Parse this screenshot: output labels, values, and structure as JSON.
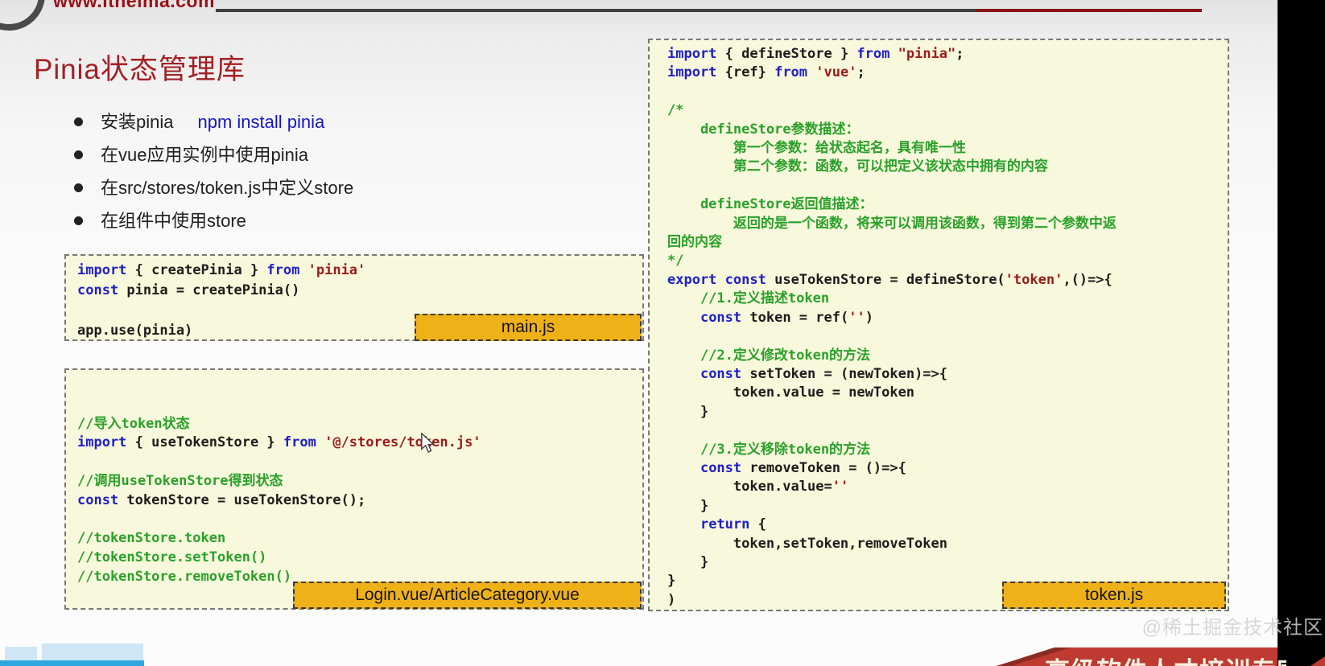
{
  "header": {
    "site_url": "www.itheima.com"
  },
  "slide": {
    "title": "Pinia状态管理库"
  },
  "bullets": [
    {
      "label": "安装pinia",
      "code": "npm install pinia"
    },
    {
      "label": "在vue应用实例中使用pinia",
      "code": ""
    },
    {
      "label": "在src/stores/token.js中定义store",
      "code": ""
    },
    {
      "label": "在组件中使用store",
      "code": ""
    }
  ],
  "code_blocks": {
    "main": {
      "label": "main.js",
      "lines": [
        [
          [
            "k",
            "import"
          ],
          [
            "p",
            " { createPinia } "
          ],
          [
            "k",
            "from"
          ],
          [
            "p",
            " "
          ],
          [
            "s",
            "'pinia'"
          ]
        ],
        [
          [
            "k",
            "const"
          ],
          [
            "p",
            " pinia = createPinia()"
          ]
        ],
        [],
        [
          [
            "p",
            "app.use(pinia)"
          ]
        ]
      ]
    },
    "component": {
      "label": "Login.vue/ArticleCategory.vue",
      "lines": [
        [],
        [],
        [
          [
            "c",
            "//导入token状态"
          ]
        ],
        [
          [
            "k",
            "import"
          ],
          [
            "p",
            " { useTokenStore } "
          ],
          [
            "k",
            "from"
          ],
          [
            "p",
            " "
          ],
          [
            "s",
            "'@/stores/token.js'"
          ]
        ],
        [],
        [
          [
            "c",
            "//调用useTokenStore得到状态"
          ]
        ],
        [
          [
            "k",
            "const"
          ],
          [
            "p",
            " tokenStore = useTokenStore();"
          ]
        ],
        [],
        [
          [
            "c",
            "//tokenStore.token"
          ]
        ],
        [
          [
            "c",
            "//tokenStore.setToken()"
          ]
        ],
        [
          [
            "c",
            "//tokenStore.removeToken()"
          ]
        ]
      ]
    },
    "token": {
      "label": "token.js",
      "lines": [
        [
          [
            "k",
            "import"
          ],
          [
            "p",
            " { defineStore } "
          ],
          [
            "k",
            "from"
          ],
          [
            "p",
            " "
          ],
          [
            "s",
            "\"pinia\""
          ],
          [
            "p",
            ";"
          ]
        ],
        [
          [
            "k",
            "import"
          ],
          [
            "p",
            " {ref} "
          ],
          [
            "k",
            "from"
          ],
          [
            "p",
            " "
          ],
          [
            "s",
            "'vue'"
          ],
          [
            "p",
            ";"
          ]
        ],
        [],
        [
          [
            "c",
            "/*"
          ]
        ],
        [
          [
            "c",
            "    defineStore参数描述："
          ]
        ],
        [
          [
            "c",
            "        第一个参数：给状态起名，具有唯一性"
          ]
        ],
        [
          [
            "c",
            "        第二个参数：函数，可以把定义该状态中拥有的内容"
          ]
        ],
        [],
        [
          [
            "c",
            "    defineStore返回值描述："
          ]
        ],
        [
          [
            "c",
            "        返回的是一个函数，将来可以调用该函数，得到第二个参数中返"
          ]
        ],
        [
          [
            "c",
            "回的内容"
          ]
        ],
        [
          [
            "c",
            "*/"
          ]
        ],
        [
          [
            "k",
            "export"
          ],
          [
            "p",
            " "
          ],
          [
            "k",
            "const"
          ],
          [
            "p",
            " useTokenStore = defineStore("
          ],
          [
            "s",
            "'token'"
          ],
          [
            "p",
            ",()=>{"
          ]
        ],
        [
          [
            "c",
            "    //1.定义描述token"
          ]
        ],
        [
          [
            "p",
            "    "
          ],
          [
            "k",
            "const"
          ],
          [
            "p",
            " token = ref("
          ],
          [
            "s",
            "''"
          ],
          [
            "p",
            ")"
          ]
        ],
        [],
        [
          [
            "c",
            "    //2.定义修改token的方法"
          ]
        ],
        [
          [
            "p",
            "    "
          ],
          [
            "k",
            "const"
          ],
          [
            "p",
            " setToken = (newToken)=>{"
          ]
        ],
        [
          [
            "p",
            "        token.value = newToken"
          ]
        ],
        [
          [
            "p",
            "    }"
          ]
        ],
        [],
        [
          [
            "c",
            "    //3.定义移除token的方法"
          ]
        ],
        [
          [
            "p",
            "    "
          ],
          [
            "k",
            "const"
          ],
          [
            "p",
            " removeToken = ()=>{"
          ]
        ],
        [
          [
            "p",
            "        token.value="
          ],
          [
            "s",
            "''"
          ]
        ],
        [
          [
            "p",
            "    }"
          ]
        ],
        [
          [
            "p",
            "    "
          ],
          [
            "k",
            "return"
          ],
          [
            "p",
            " {"
          ]
        ],
        [
          [
            "p",
            "        token,setToken,removeToken"
          ]
        ],
        [
          [
            "p",
            "    }"
          ]
        ],
        [
          [
            "p",
            "}"
          ]
        ],
        [
          [
            "p",
            ")"
          ]
        ]
      ]
    }
  },
  "footer": {
    "banner_text": "高级软件人才培训专家",
    "watermark": "@稀土掘金技术社区"
  },
  "colors": {
    "keyword": "#1f1fc8",
    "string": "#9b1b1b",
    "comment": "#2aa12a",
    "code_bg": "#f8f8dc",
    "label_bg": "#efb118",
    "title_red": "#a32024",
    "banner_red": "#bf3a30"
  }
}
